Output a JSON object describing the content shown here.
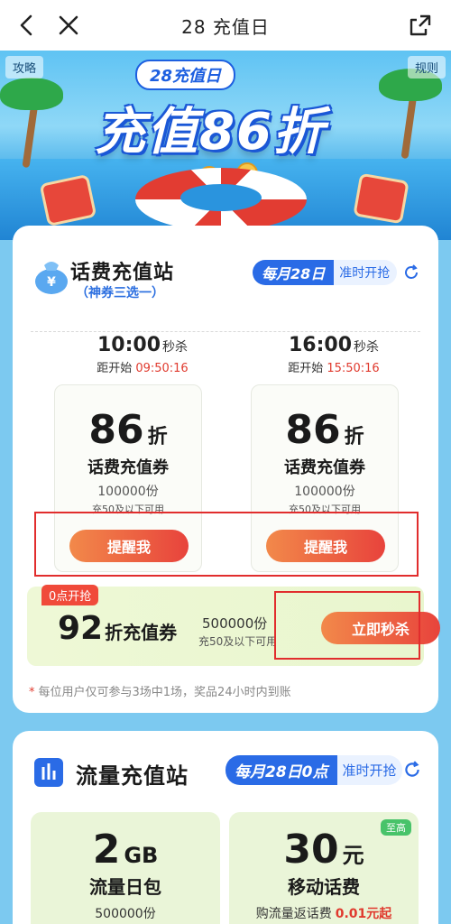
{
  "nav": {
    "title": "28 充值日"
  },
  "hero": {
    "tag_left": "攻略",
    "tag_right": "规则",
    "badge": "28充值日",
    "headline": "充值86折"
  },
  "card1": {
    "title": "话费充值站",
    "subtitle": "（神券三选一）",
    "date_highlight": "每月28日",
    "date_text": "准时开抢",
    "sessions": [
      {
        "time": "10:00",
        "kill": "秒杀",
        "countdown_label": "距开始",
        "countdown": "09:50:16",
        "discount": "86",
        "discount_unit": "折",
        "name": "话费充值券",
        "qty": "100000份",
        "cond": "充50及以下可用",
        "button": "提醒我"
      },
      {
        "time": "16:00",
        "kill": "秒杀",
        "countdown_label": "距开始",
        "countdown": "15:50:16",
        "discount": "86",
        "discount_unit": "折",
        "name": "话费充值券",
        "qty": "100000份",
        "cond": "充50及以下可用",
        "button": "提醒我"
      }
    ],
    "flash": {
      "tag": "0点开抢",
      "discount": "92",
      "name": "折充值券",
      "qty": "500000份",
      "cond": "充50及以下可用",
      "button": "立即秒杀"
    },
    "note_star": "*",
    "note": "每位用户仅可参与3场中1场，奖品24小时内到账"
  },
  "card2": {
    "title": "流量充值站",
    "date_highlight": "每月28日0点",
    "date_text": "准时开抢",
    "packages": [
      {
        "amount": "2",
        "unit": "GB",
        "name": "流量日包",
        "sub": "500000份",
        "sub_price": ""
      },
      {
        "amount": "30",
        "unit": "元",
        "name": "移动话费",
        "sub": "购流量返话费",
        "sub_price": "0.01元起",
        "badge": "至高"
      }
    ]
  },
  "colors": {
    "accent_blue": "#2a6be6",
    "accent_red": "#e8433c",
    "countdown_red": "#e03a2e"
  }
}
